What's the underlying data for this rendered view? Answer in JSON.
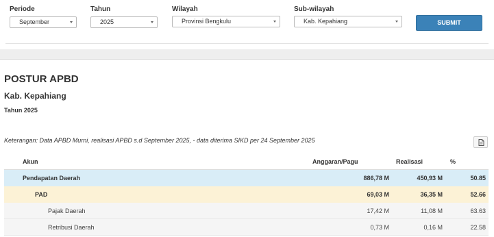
{
  "filters": {
    "periode": {
      "label": "Periode",
      "value": "September"
    },
    "tahun": {
      "label": "Tahun",
      "value": "2025"
    },
    "wilayah": {
      "label": "Wilayah",
      "value": "Provinsi Bengkulu"
    },
    "subwilayah": {
      "label": "Sub-wilayah",
      "value": "Kab. Kepahiang"
    },
    "submit_label": "SUBMIT"
  },
  "report": {
    "title": "POSTUR APBD",
    "region": "Kab. Kepahiang",
    "year": "Tahun 2025",
    "note": "Keterangan: Data APBD Murni, realisasi APBD s.d September 2025, - data diterima SIKD per 24 September 2025",
    "export_icon": "document-export-icon"
  },
  "table": {
    "headers": {
      "akun": "Akun",
      "anggaran": "Anggaran/Pagu",
      "realisasi": "Realisasi",
      "persen": "%"
    },
    "rows": [
      {
        "akun": "Pendapatan Daerah",
        "anggaran": "886,78 M",
        "realisasi": "450,93 M",
        "persen": "50.85",
        "level": 0
      },
      {
        "akun": "PAD",
        "anggaran": "69,03 M",
        "realisasi": "36,35 M",
        "persen": "52.66",
        "level": 1
      },
      {
        "akun": "Pajak Daerah",
        "anggaran": "17,42 M",
        "realisasi": "11,08 M",
        "persen": "63.63",
        "level": 2
      },
      {
        "akun": "Retribusi Daerah",
        "anggaran": "0,73 M",
        "realisasi": "0,16 M",
        "persen": "22.58",
        "level": 2
      }
    ]
  },
  "colors": {
    "submit": "#3b82b8",
    "level0_row": "#d9edf7",
    "level1_row": "#fcf2d6",
    "level2_row": "#f5f5f5"
  }
}
